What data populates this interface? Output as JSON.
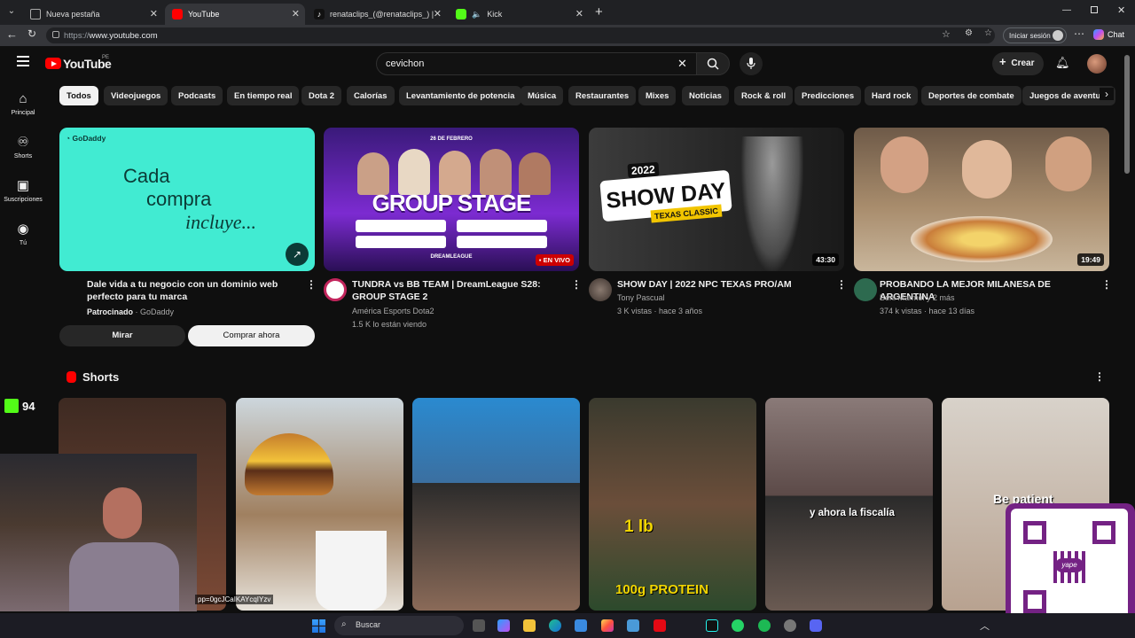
{
  "browser": {
    "tabs": [
      {
        "label": "Nueva pestaña"
      },
      {
        "label": "YouTube"
      },
      {
        "label": "renataclips_(@renataclips_) | TikTo"
      },
      {
        "label": "Kick"
      }
    ],
    "url_proto": "https://",
    "url_host": "www.youtube.com",
    "signin_label": "Iniciar sesión",
    "chat_label": "Chat"
  },
  "youtube": {
    "logo_text": "YouTube",
    "region": "PE",
    "search_value": "cevichon",
    "create_label": "Crear",
    "sidebar": [
      {
        "label": "Principal",
        "icon": "home-icon"
      },
      {
        "label": "Shorts",
        "icon": "shorts-icon"
      },
      {
        "label": "Suscripciones",
        "icon": "subscriptions-icon"
      },
      {
        "label": "Tú",
        "icon": "you-icon"
      }
    ],
    "chips": [
      "Todos",
      "Videojuegos",
      "Podcasts",
      "En tiempo real",
      "Dota 2",
      "Calorías",
      "Levantamiento de potencia",
      "Música",
      "Restaurantes",
      "Mixes",
      "Noticias",
      "Rock & roll",
      "Predicciones",
      "Hard rock",
      "Deportes de combate",
      "Juegos de aventura"
    ],
    "ad": {
      "brand": "GoDaddy",
      "thumb_line1": "Cada",
      "thumb_line2": "compra",
      "thumb_line3": "incluye...",
      "title": "Dale vida a tu negocio con un dominio web perfecto para tu marca",
      "sponsored": "Patrocinado",
      "advertiser": "· GoDaddy",
      "btn_view": "Mirar",
      "btn_buy": "Comprar ahora"
    },
    "videos": [
      {
        "title": "TUNDRA vs BB TEAM | DreamLeague S28: GROUP STAGE 2",
        "channel": "América Esports Dota2",
        "meta": "1.5 K lo están viendo",
        "thumb_date": "26 DE FEBRERO",
        "thumb_title": "GROUP STAGE",
        "thumb_footer": "DREAMLEAGUE",
        "live_label": "EN VIVO"
      },
      {
        "title": "SHOW DAY | 2022 NPC TEXAS PRO/AM",
        "channel": "Tony Pascual",
        "meta": "3 K vistas · hace 3 años",
        "thumb_year": "2022",
        "thumb_title": "SHOW DAY",
        "thumb_sub": "TEXAS CLASSIC",
        "duration": "43:30"
      },
      {
        "title": "PROBANDO LA MEJOR MILANESA DE ARGENTINA",
        "channel": "Beni Marmol y 2 más",
        "meta": "374 k vistas · hace 13 días",
        "duration": "19:49"
      }
    ],
    "shorts_heading": "Shorts",
    "shorts_captions": [
      "1 lb",
      "100g PROTEIN",
      "y ahora la fiscalía",
      "Be patient"
    ]
  },
  "overlay": {
    "kick_count": "94",
    "stream_text": "pp=0gcJCaIKAYcqIYzv",
    "qr_label": "yape"
  },
  "taskbar": {
    "search_label": "Buscar"
  }
}
